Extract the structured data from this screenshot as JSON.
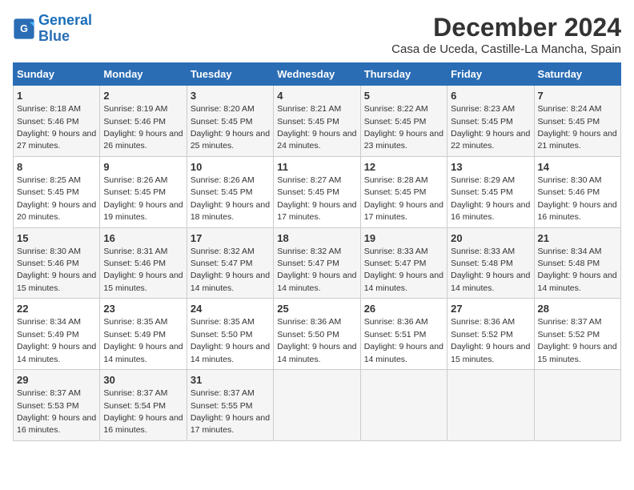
{
  "logo": {
    "line1": "General",
    "line2": "Blue"
  },
  "title": "December 2024",
  "subtitle": "Casa de Uceda, Castille-La Mancha, Spain",
  "headers": [
    "Sunday",
    "Monday",
    "Tuesday",
    "Wednesday",
    "Thursday",
    "Friday",
    "Saturday"
  ],
  "weeks": [
    [
      {
        "day": "1",
        "sunrise": "Sunrise: 8:18 AM",
        "sunset": "Sunset: 5:46 PM",
        "daylight": "Daylight: 9 hours and 27 minutes."
      },
      {
        "day": "2",
        "sunrise": "Sunrise: 8:19 AM",
        "sunset": "Sunset: 5:46 PM",
        "daylight": "Daylight: 9 hours and 26 minutes."
      },
      {
        "day": "3",
        "sunrise": "Sunrise: 8:20 AM",
        "sunset": "Sunset: 5:45 PM",
        "daylight": "Daylight: 9 hours and 25 minutes."
      },
      {
        "day": "4",
        "sunrise": "Sunrise: 8:21 AM",
        "sunset": "Sunset: 5:45 PM",
        "daylight": "Daylight: 9 hours and 24 minutes."
      },
      {
        "day": "5",
        "sunrise": "Sunrise: 8:22 AM",
        "sunset": "Sunset: 5:45 PM",
        "daylight": "Daylight: 9 hours and 23 minutes."
      },
      {
        "day": "6",
        "sunrise": "Sunrise: 8:23 AM",
        "sunset": "Sunset: 5:45 PM",
        "daylight": "Daylight: 9 hours and 22 minutes."
      },
      {
        "day": "7",
        "sunrise": "Sunrise: 8:24 AM",
        "sunset": "Sunset: 5:45 PM",
        "daylight": "Daylight: 9 hours and 21 minutes."
      }
    ],
    [
      {
        "day": "8",
        "sunrise": "Sunrise: 8:25 AM",
        "sunset": "Sunset: 5:45 PM",
        "daylight": "Daylight: 9 hours and 20 minutes."
      },
      {
        "day": "9",
        "sunrise": "Sunrise: 8:26 AM",
        "sunset": "Sunset: 5:45 PM",
        "daylight": "Daylight: 9 hours and 19 minutes."
      },
      {
        "day": "10",
        "sunrise": "Sunrise: 8:26 AM",
        "sunset": "Sunset: 5:45 PM",
        "daylight": "Daylight: 9 hours and 18 minutes."
      },
      {
        "day": "11",
        "sunrise": "Sunrise: 8:27 AM",
        "sunset": "Sunset: 5:45 PM",
        "daylight": "Daylight: 9 hours and 17 minutes."
      },
      {
        "day": "12",
        "sunrise": "Sunrise: 8:28 AM",
        "sunset": "Sunset: 5:45 PM",
        "daylight": "Daylight: 9 hours and 17 minutes."
      },
      {
        "day": "13",
        "sunrise": "Sunrise: 8:29 AM",
        "sunset": "Sunset: 5:45 PM",
        "daylight": "Daylight: 9 hours and 16 minutes."
      },
      {
        "day": "14",
        "sunrise": "Sunrise: 8:30 AM",
        "sunset": "Sunset: 5:46 PM",
        "daylight": "Daylight: 9 hours and 16 minutes."
      }
    ],
    [
      {
        "day": "15",
        "sunrise": "Sunrise: 8:30 AM",
        "sunset": "Sunset: 5:46 PM",
        "daylight": "Daylight: 9 hours and 15 minutes."
      },
      {
        "day": "16",
        "sunrise": "Sunrise: 8:31 AM",
        "sunset": "Sunset: 5:46 PM",
        "daylight": "Daylight: 9 hours and 15 minutes."
      },
      {
        "day": "17",
        "sunrise": "Sunrise: 8:32 AM",
        "sunset": "Sunset: 5:47 PM",
        "daylight": "Daylight: 9 hours and 14 minutes."
      },
      {
        "day": "18",
        "sunrise": "Sunrise: 8:32 AM",
        "sunset": "Sunset: 5:47 PM",
        "daylight": "Daylight: 9 hours and 14 minutes."
      },
      {
        "day": "19",
        "sunrise": "Sunrise: 8:33 AM",
        "sunset": "Sunset: 5:47 PM",
        "daylight": "Daylight: 9 hours and 14 minutes."
      },
      {
        "day": "20",
        "sunrise": "Sunrise: 8:33 AM",
        "sunset": "Sunset: 5:48 PM",
        "daylight": "Daylight: 9 hours and 14 minutes."
      },
      {
        "day": "21",
        "sunrise": "Sunrise: 8:34 AM",
        "sunset": "Sunset: 5:48 PM",
        "daylight": "Daylight: 9 hours and 14 minutes."
      }
    ],
    [
      {
        "day": "22",
        "sunrise": "Sunrise: 8:34 AM",
        "sunset": "Sunset: 5:49 PM",
        "daylight": "Daylight: 9 hours and 14 minutes."
      },
      {
        "day": "23",
        "sunrise": "Sunrise: 8:35 AM",
        "sunset": "Sunset: 5:49 PM",
        "daylight": "Daylight: 9 hours and 14 minutes."
      },
      {
        "day": "24",
        "sunrise": "Sunrise: 8:35 AM",
        "sunset": "Sunset: 5:50 PM",
        "daylight": "Daylight: 9 hours and 14 minutes."
      },
      {
        "day": "25",
        "sunrise": "Sunrise: 8:36 AM",
        "sunset": "Sunset: 5:50 PM",
        "daylight": "Daylight: 9 hours and 14 minutes."
      },
      {
        "day": "26",
        "sunrise": "Sunrise: 8:36 AM",
        "sunset": "Sunset: 5:51 PM",
        "daylight": "Daylight: 9 hours and 14 minutes."
      },
      {
        "day": "27",
        "sunrise": "Sunrise: 8:36 AM",
        "sunset": "Sunset: 5:52 PM",
        "daylight": "Daylight: 9 hours and 15 minutes."
      },
      {
        "day": "28",
        "sunrise": "Sunrise: 8:37 AM",
        "sunset": "Sunset: 5:52 PM",
        "daylight": "Daylight: 9 hours and 15 minutes."
      }
    ],
    [
      {
        "day": "29",
        "sunrise": "Sunrise: 8:37 AM",
        "sunset": "Sunset: 5:53 PM",
        "daylight": "Daylight: 9 hours and 16 minutes."
      },
      {
        "day": "30",
        "sunrise": "Sunrise: 8:37 AM",
        "sunset": "Sunset: 5:54 PM",
        "daylight": "Daylight: 9 hours and 16 minutes."
      },
      {
        "day": "31",
        "sunrise": "Sunrise: 8:37 AM",
        "sunset": "Sunset: 5:55 PM",
        "daylight": "Daylight: 9 hours and 17 minutes."
      },
      null,
      null,
      null,
      null
    ]
  ]
}
